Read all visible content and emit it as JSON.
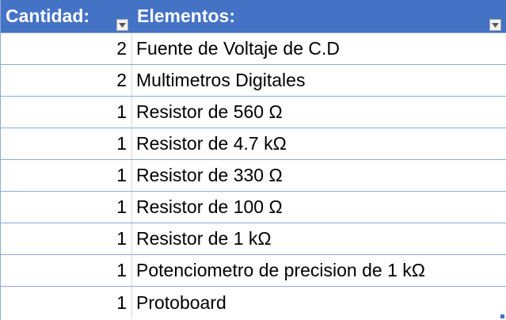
{
  "header": {
    "qty_label": "Cantidad:",
    "items_label": "Elementos:"
  },
  "icons": {
    "filter": "filter-dropdown-icon",
    "resize": "table-resize-handle"
  },
  "colors": {
    "header_bg": "#4472c4",
    "header_text": "#ffffff",
    "row_border": "#8eaadb"
  },
  "rows": [
    {
      "qty": "2",
      "item": "Fuente de Voltaje de C.D"
    },
    {
      "qty": "2",
      "item": "Multimetros Digitales"
    },
    {
      "qty": "1",
      "item": "Resistor de 560 Ω"
    },
    {
      "qty": "1",
      "item": "Resistor de 4.7 kΩ"
    },
    {
      "qty": "1",
      "item": "Resistor de 330 Ω"
    },
    {
      "qty": "1",
      "item": "Resistor de 100 Ω"
    },
    {
      "qty": "1",
      "item": "Resistor de 1 kΩ"
    },
    {
      "qty": "1",
      "item": "Potenciometro de precision de 1 kΩ"
    },
    {
      "qty": "1",
      "item": "Protoboard"
    }
  ]
}
